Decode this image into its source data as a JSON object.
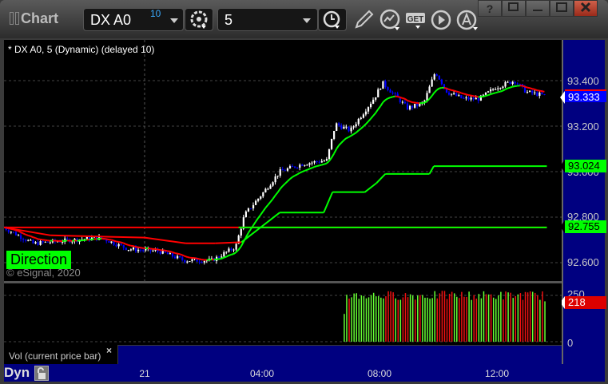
{
  "window": {
    "title": "Chart",
    "help": "?",
    "buttons": [
      "help",
      "restore-menu",
      "minimize",
      "maximize",
      "close"
    ]
  },
  "toolbar": {
    "symbol": "DX A0",
    "delay_badge": "10",
    "interval": "5"
  },
  "chart": {
    "study_label": "* DX A0, 5 (Dynamic) (delayed 10)",
    "direction_label": "Direction",
    "copyright": "© eSignal, 2020",
    "price_labels": [
      "93.400",
      "93.200",
      "93.000",
      "92.800",
      "92.600"
    ],
    "last_price_tag": "93.333",
    "upper_tag": "93.024",
    "lower_tag": "92.755",
    "colors": {
      "up": "#ffffff",
      "down": "#0000ff",
      "ma_up": "#00ff00",
      "ma_down": "#ff0000",
      "tag_blue": "#0000ff",
      "tag_green": "#00ff00",
      "tag_red": "#dd0000"
    }
  },
  "volume": {
    "legend": "Vol (current price bar)",
    "close": "×",
    "labels": [
      "250",
      "0"
    ],
    "last_tag": "218"
  },
  "time_axis": {
    "labels": [
      "21",
      "04:00",
      "08:00",
      "12:00"
    ],
    "mode": "Dyn"
  },
  "chart_data": {
    "type": "candlestick",
    "x_unit": "hours from 00:00 on the 21st",
    "bar_minutes": 5,
    "price_path": [
      [
        -4.8,
        92.755
      ],
      [
        -3.8,
        92.684
      ],
      [
        -2.45,
        92.7
      ],
      [
        -1.5,
        92.71
      ],
      [
        -0.55,
        92.66
      ],
      [
        0.5,
        92.65
      ],
      [
        1.35,
        92.61
      ],
      [
        2.3,
        92.61
      ],
      [
        3.1,
        92.67
      ],
      [
        3.4,
        92.81
      ],
      [
        4.05,
        92.91
      ],
      [
        4.6,
        93.0
      ],
      [
        5.4,
        93.035
      ],
      [
        6.2,
        93.05
      ],
      [
        6.5,
        93.21
      ],
      [
        7.0,
        93.18
      ],
      [
        7.85,
        93.33
      ],
      [
        8.1,
        93.39
      ],
      [
        8.95,
        93.28
      ],
      [
        9.5,
        93.3
      ],
      [
        9.9,
        93.44
      ],
      [
        10.3,
        93.35
      ],
      [
        10.85,
        93.32
      ],
      [
        11.4,
        93.32
      ],
      [
        11.95,
        93.37
      ],
      [
        12.6,
        93.4
      ],
      [
        13.0,
        93.35
      ],
      [
        13.7,
        93.333
      ]
    ],
    "trail_line": [
      [
        -4.8,
        92.755
      ],
      [
        -3.2,
        92.72
      ],
      [
        0,
        92.71
      ],
      [
        1.4,
        92.685
      ],
      [
        2.4,
        92.685
      ],
      [
        3.3,
        92.69
      ],
      [
        4.0,
        92.76
      ],
      [
        4.6,
        92.82
      ],
      [
        6.1,
        92.82
      ],
      [
        6.4,
        92.91
      ],
      [
        7.5,
        92.91
      ],
      [
        7.9,
        92.95
      ],
      [
        8.2,
        92.99
      ],
      [
        9.7,
        92.99
      ],
      [
        9.85,
        93.024
      ],
      [
        13.7,
        93.024
      ]
    ],
    "horizontal_line": 92.755,
    "volume_start": 6.8,
    "volume_range": [
      0,
      250
    ],
    "ylim": [
      92.5,
      93.55
    ]
  }
}
